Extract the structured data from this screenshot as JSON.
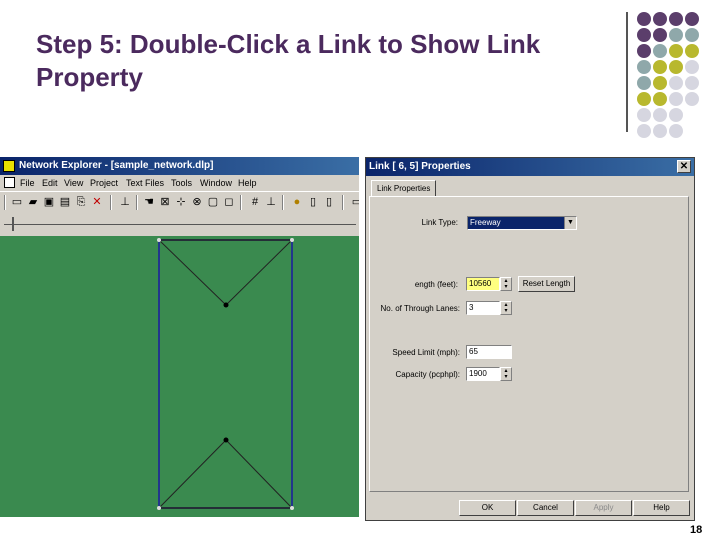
{
  "slide": {
    "title": "Step 5: Double-Click a Link to Show Link Property",
    "page_number": "18"
  },
  "decor_colors": {
    "purple": "#5b3e6b",
    "teal": "#8fa8aa",
    "olive": "#b8b82e",
    "light": "#d6d6e0"
  },
  "network_window": {
    "title": "Network Explorer - [sample_network.dlp]",
    "menu": [
      "File",
      "Edit",
      "View",
      "Project",
      "Text Files",
      "Tools",
      "Window",
      "Help"
    ],
    "canvas_color": "#3a8a4f",
    "toolbar_icons": [
      "new-icon",
      "open-icon",
      "save-icon",
      "print-icon",
      "copy-icon",
      "delete-icon",
      "node-icon",
      "hand-icon",
      "zoom-icon",
      "select-icon",
      "pan-icon",
      "window-icon",
      "grid-icon",
      "lock-icon",
      "help-icon",
      "doc-icon",
      "export-icon"
    ]
  },
  "dialog": {
    "title": "Link [    6,     5] Properties",
    "close": "✕",
    "tab": "Link Properties",
    "link_type_label": "Link Type:",
    "link_type_value": "Freeway",
    "length_label": "ength (feet):",
    "length_value": "10560",
    "reset_length": "Reset Length",
    "lanes_label": "No. of Through Lanes:",
    "lanes_value": "3",
    "speed_label": "Speed Limit (mph):",
    "speed_value": "65",
    "capacity_label": "Capacity (pcphpl):",
    "capacity_value": "1900",
    "buttons": {
      "ok": "OK",
      "cancel": "Cancel",
      "apply": "Apply",
      "help": "Help"
    }
  }
}
